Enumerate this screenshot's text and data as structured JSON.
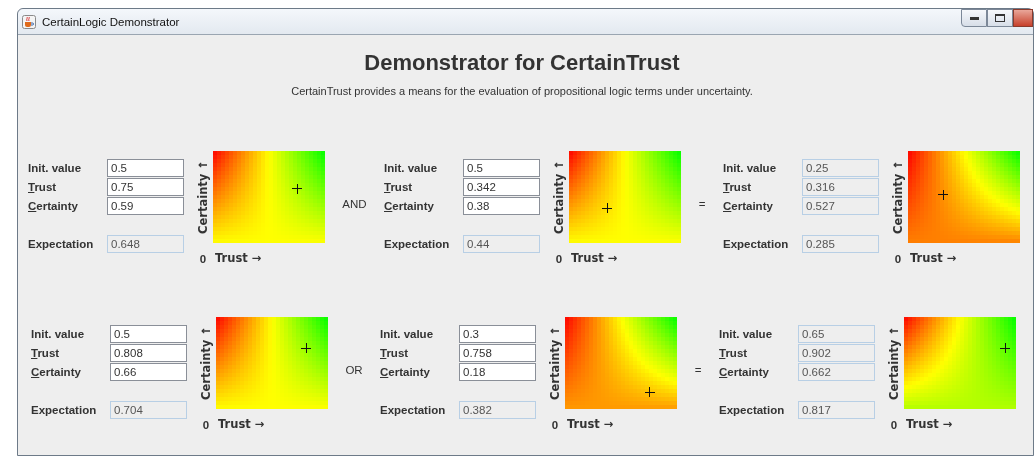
{
  "window": {
    "title": "CertainLogic Demonstrator"
  },
  "heading": "Demonstrator for CertainTrust",
  "subtitle": "CertainTrust provides a means for the evaluation of propositional logic terms under uncertainty.",
  "rows": [
    {
      "operator": "AND",
      "equals": "=",
      "operands": [
        {
          "editable": true,
          "fields": [
            {
              "label": "Init. value",
              "value": "0.5",
              "mnemonic": false
            },
            {
              "label": "Trust",
              "value": "0.75",
              "mnemonic": true
            },
            {
              "label": "Certainty",
              "value": "0.59",
              "mnemonic": true
            }
          ],
          "expectation_label": "Expectation",
          "expectation": "0.648",
          "plot": {
            "y_label": "Certainty ↑",
            "origin": "0",
            "x_label": "Trust →"
          }
        },
        {
          "editable": true,
          "fields": [
            {
              "label": "Init. value",
              "value": "0.5",
              "mnemonic": false
            },
            {
              "label": "Trust",
              "value": "0.342",
              "mnemonic": true
            },
            {
              "label": "Certainty",
              "value": "0.38",
              "mnemonic": true
            }
          ],
          "expectation_label": "Expectation",
          "expectation": "0.44",
          "plot": {
            "y_label": "Certainty ↑",
            "origin": "0",
            "x_label": "Trust →"
          }
        },
        {
          "editable": false,
          "fields": [
            {
              "label": "Init. value",
              "value": "0.25",
              "mnemonic": false
            },
            {
              "label": "Trust",
              "value": "0.316",
              "mnemonic": true
            },
            {
              "label": "Certainty",
              "value": "0.527",
              "mnemonic": true
            }
          ],
          "expectation_label": "Expectation",
          "expectation": "0.285",
          "plot": {
            "y_label": "Certainty ↑",
            "origin": "0",
            "x_label": "Trust →"
          }
        }
      ]
    },
    {
      "operator": "OR",
      "equals": "=",
      "operands": [
        {
          "editable": true,
          "fields": [
            {
              "label": "Init. value",
              "value": "0.5",
              "mnemonic": false
            },
            {
              "label": "Trust",
              "value": "0.808",
              "mnemonic": true
            },
            {
              "label": "Certainty",
              "value": "0.66",
              "mnemonic": true
            }
          ],
          "expectation_label": "Expectation",
          "expectation": "0.704",
          "plot": {
            "y_label": "Certainty ↑",
            "origin": "0",
            "x_label": "Trust →"
          }
        },
        {
          "editable": true,
          "fields": [
            {
              "label": "Init. value",
              "value": "0.3",
              "mnemonic": false
            },
            {
              "label": "Trust",
              "value": "0.758",
              "mnemonic": true
            },
            {
              "label": "Certainty",
              "value": "0.18",
              "mnemonic": true
            }
          ],
          "expectation_label": "Expectation",
          "expectation": "0.382",
          "plot": {
            "y_label": "Certainty ↑",
            "origin": "0",
            "x_label": "Trust →"
          }
        },
        {
          "editable": false,
          "fields": [
            {
              "label": "Init. value",
              "value": "0.65",
              "mnemonic": false
            },
            {
              "label": "Trust",
              "value": "0.902",
              "mnemonic": true
            },
            {
              "label": "Certainty",
              "value": "0.662",
              "mnemonic": true
            }
          ],
          "expectation_label": "Expectation",
          "expectation": "0.817",
          "plot": {
            "y_label": "Certainty ↑",
            "origin": "0",
            "x_label": "Trust →"
          }
        }
      ]
    }
  ]
}
